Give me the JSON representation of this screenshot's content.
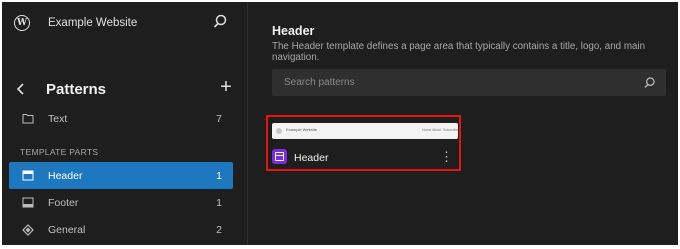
{
  "site": {
    "name": "Example Website"
  },
  "sidebar": {
    "title": "Patterns",
    "items": [
      {
        "label": "Text",
        "count": "7",
        "icon": "folder-icon"
      },
      {
        "label": "Header",
        "count": "1",
        "icon": "header-layout-icon",
        "active": true
      },
      {
        "label": "Footer",
        "count": "1",
        "icon": "footer-layout-icon"
      },
      {
        "label": "General",
        "count": "2",
        "icon": "diamond-icon"
      }
    ],
    "section_label": "TEMPLATE PARTS"
  },
  "main": {
    "title": "Header",
    "description": "The Header template defines a page area that typically contains a title, logo, and main navigation.",
    "search": {
      "placeholder": "Search patterns"
    },
    "card": {
      "title": "Header",
      "preview": {
        "site_name": "Example Website",
        "nav": [
          "Home",
          "About",
          "Subscribe"
        ]
      },
      "icon": "template-part-icon"
    }
  },
  "colors": {
    "background": "#1e1e1e",
    "active": "#1e78c0",
    "highlight": "#e31414",
    "icon": "#7b2cdf"
  }
}
